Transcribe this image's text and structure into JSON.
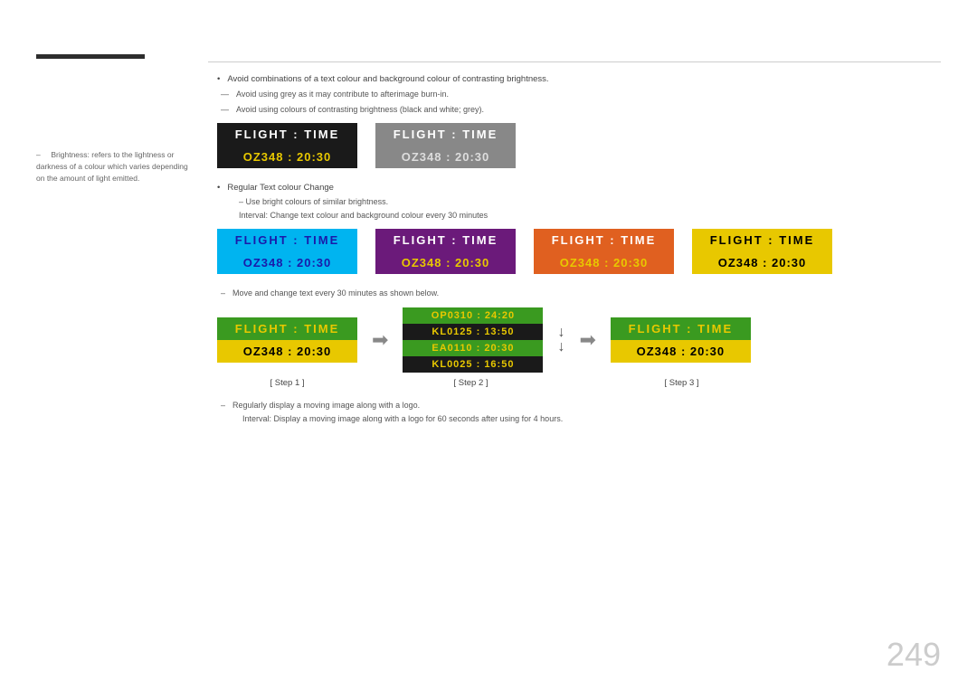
{
  "page": {
    "number": "249"
  },
  "sidebar": {
    "note": "Brightness: refers to the lightness or darkness of a colour which varies depending on the amount of light emitted."
  },
  "content": {
    "bullet1": "Avoid combinations of a text colour and background colour of contrasting brightness.",
    "dash1": "Avoid using grey as it may contribute to afterimage burn-in.",
    "dash2": "Avoid using colours of contrasting brightness (black and white; grey).",
    "bullet2": "Regular Text colour Change",
    "sub1": "Use bright colours of similar brightness.",
    "sub2": "Interval: Change text colour and background colour every 30 minutes",
    "dash3": "Move and change text every 30 minutes as shown below.",
    "bottomNote1": "Regularly display a moving image along with a logo.",
    "bottomNote2": "Interval: Display a moving image along with a logo for 60 seconds after using for 4 hours."
  },
  "boards": {
    "main": {
      "dark": {
        "header": "FLIGHT  :  TIME",
        "body": "OZ348  :  20:30"
      },
      "grey": {
        "header": "FLIGHT  :  TIME",
        "body": "OZ348  :  20:30"
      }
    },
    "variants": {
      "cyan": {
        "header": "FLIGHT  :  TIME",
        "body": "OZ348  :  20:30"
      },
      "purple": {
        "header": "FLIGHT  :  TIME",
        "body": "OZ348  :  20:30"
      },
      "orange": {
        "header": "FLIGHT  :  TIME",
        "body": "OZ348  :  20:30"
      },
      "yellow": {
        "header": "FLIGHT  :  TIME",
        "body": "OZ348  :  20:30"
      }
    }
  },
  "steps": {
    "step1": {
      "header": "FLIGHT  :  TIME",
      "body": "OZ348  :  20:30",
      "label": "[ Step 1 ]"
    },
    "step2": {
      "row1": "OP0310  :  24:20",
      "row2": "KL0125  :  13:50",
      "row3": "EA0110  :  20:30",
      "row4": "KL0025  :  16:50",
      "label": "[ Step 2 ]"
    },
    "step3": {
      "header": "FLIGHT  :  TIME",
      "body": "OZ348  :  20:30",
      "label": "[ Step 3 ]"
    }
  }
}
